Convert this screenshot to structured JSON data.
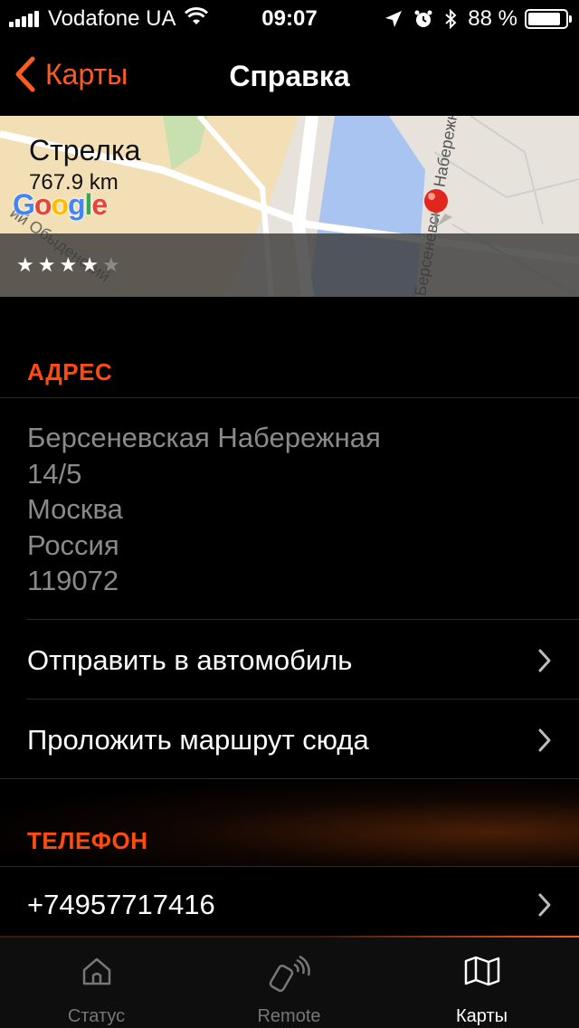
{
  "status_bar": {
    "carrier": "Vodafone UA",
    "time": "09:07",
    "battery": "88 %"
  },
  "nav": {
    "back_label": "Карты",
    "title": "Справка"
  },
  "map": {
    "place_name": "Стрелка",
    "distance": "767.9 km",
    "rating_stars": 4,
    "rating_max": 5,
    "google_logo": "Google",
    "street_labels": [
      "Берсеневская Набережная",
      "ий Обыденский"
    ]
  },
  "address_section": {
    "header": "АДРЕС",
    "lines": [
      "Берсеневская Набережная",
      "14/5",
      "Москва",
      "Россия",
      "119072"
    ],
    "actions": [
      {
        "label": "Отправить в автомобиль"
      },
      {
        "label": "Проложить маршрут сюда"
      }
    ]
  },
  "phone_section": {
    "header": "ТЕЛЕФОН",
    "number": "+74957717416"
  },
  "tab_bar": {
    "tabs": [
      {
        "label": "Статус",
        "icon": "home-icon",
        "active": false
      },
      {
        "label": "Remote",
        "icon": "remote-key-icon",
        "active": false
      },
      {
        "label": "Карты",
        "icon": "map-icon",
        "active": true
      }
    ]
  },
  "colors": {
    "accent": "#ff5a1f",
    "header_accent": "#ff4a10",
    "background": "#000000",
    "muted_text": "#8a8a8a"
  }
}
